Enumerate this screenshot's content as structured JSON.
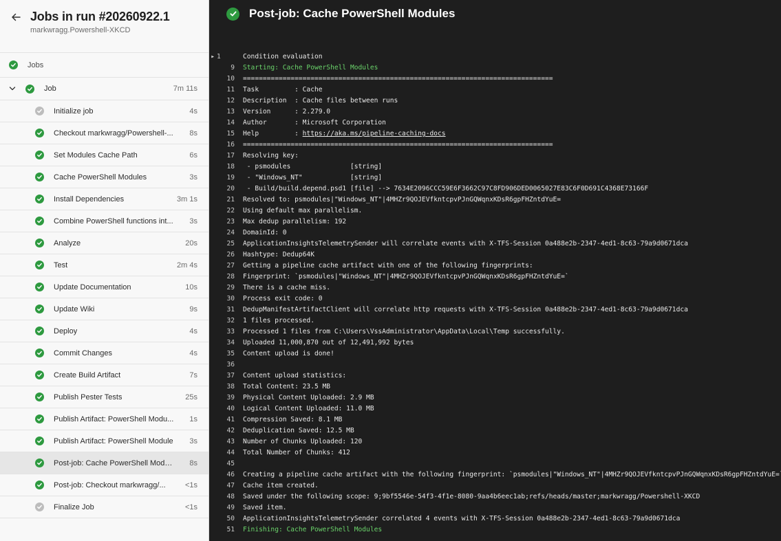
{
  "sidebar": {
    "title": "Jobs in run #20260922.1",
    "subtitle": "markwragg.Powershell-XKCD",
    "jobs_label": "Jobs",
    "job": {
      "label": "Job",
      "duration": "7m 11s"
    },
    "steps": [
      {
        "label": "Initialize job",
        "duration": "4s",
        "status": "skipped"
      },
      {
        "label": "Checkout markwragg/Powershell-...",
        "duration": "8s",
        "status": "succeeded"
      },
      {
        "label": "Set Modules Cache Path",
        "duration": "6s",
        "status": "succeeded"
      },
      {
        "label": "Cache PowerShell Modules",
        "duration": "3s",
        "status": "succeeded"
      },
      {
        "label": "Install Dependencies",
        "duration": "3m 1s",
        "status": "succeeded"
      },
      {
        "label": "Combine PowerShell functions int...",
        "duration": "3s",
        "status": "succeeded"
      },
      {
        "label": "Analyze",
        "duration": "20s",
        "status": "succeeded"
      },
      {
        "label": "Test",
        "duration": "2m 4s",
        "status": "succeeded"
      },
      {
        "label": "Update Documentation",
        "duration": "10s",
        "status": "succeeded"
      },
      {
        "label": "Update Wiki",
        "duration": "9s",
        "status": "succeeded"
      },
      {
        "label": "Deploy",
        "duration": "4s",
        "status": "succeeded"
      },
      {
        "label": "Commit Changes",
        "duration": "4s",
        "status": "succeeded"
      },
      {
        "label": "Create Build Artifact",
        "duration": "7s",
        "status": "succeeded"
      },
      {
        "label": "Publish Pester Tests",
        "duration": "25s",
        "status": "succeeded"
      },
      {
        "label": "Publish Artifact: PowerShell Modu...",
        "duration": "1s",
        "status": "succeeded"
      },
      {
        "label": "Publish Artifact: PowerShell Module",
        "duration": "3s",
        "status": "succeeded"
      },
      {
        "label": "Post-job: Cache PowerShell Modu...",
        "duration": "8s",
        "status": "succeeded",
        "selected": true
      },
      {
        "label": "Post-job: Checkout markwragg/...",
        "duration": "<1s",
        "status": "succeeded"
      },
      {
        "label": "Finalize Job",
        "duration": "<1s",
        "status": "skipped"
      }
    ]
  },
  "main": {
    "title": "Post-job: Cache PowerShell Modules",
    "log": [
      {
        "n": "1",
        "text": "Condition evaluation",
        "collapsed": true
      },
      {
        "n": "9",
        "text": "Starting: Cache PowerShell Modules",
        "style": "green"
      },
      {
        "n": "10",
        "text": "=============================================================================="
      },
      {
        "n": "11",
        "text": "Task         : Cache"
      },
      {
        "n": "12",
        "text": "Description  : Cache files between runs"
      },
      {
        "n": "13",
        "text": "Version      : 2.279.0"
      },
      {
        "n": "14",
        "text": "Author       : Microsoft Corporation"
      },
      {
        "n": "15",
        "text": "Help         : ",
        "link": "https://aka.ms/pipeline-caching-docs"
      },
      {
        "n": "16",
        "text": "=============================================================================="
      },
      {
        "n": "17",
        "text": "Resolving key:"
      },
      {
        "n": "18",
        "text": " - psmodules               [string]"
      },
      {
        "n": "19",
        "text": " - \"Windows_NT\"            [string]"
      },
      {
        "n": "20",
        "text": " - Build/build.depend.psd1 [file] --> 7634E2096CCC59E6F3662C97C8FD906DED0065027E83C6F0D691C4368E73166F"
      },
      {
        "n": "21",
        "text": "Resolved to: psmodules|\"Windows_NT\"|4MHZr9QOJEVfkntcpvPJnGQWqnxKDsR6gpFHZntdYuE="
      },
      {
        "n": "22",
        "text": "Using default max parallelism."
      },
      {
        "n": "23",
        "text": "Max dedup parallelism: 192"
      },
      {
        "n": "24",
        "text": "DomainId: 0"
      },
      {
        "n": "25",
        "text": "ApplicationInsightsTelemetrySender will correlate events with X-TFS-Session 0a488e2b-2347-4ed1-8c63-79a9d0671dca"
      },
      {
        "n": "26",
        "text": "Hashtype: Dedup64K"
      },
      {
        "n": "27",
        "text": "Getting a pipeline cache artifact with one of the following fingerprints:"
      },
      {
        "n": "28",
        "text": "Fingerprint: `psmodules|\"Windows_NT\"|4MHZr9QOJEVfkntcpvPJnGQWqnxKDsR6gpFHZntdYuE=`"
      },
      {
        "n": "29",
        "text": "There is a cache miss."
      },
      {
        "n": "30",
        "text": "Process exit code: 0"
      },
      {
        "n": "31",
        "text": "DedupManifestArtifactClient will correlate http requests with X-TFS-Session 0a488e2b-2347-4ed1-8c63-79a9d0671dca"
      },
      {
        "n": "32",
        "text": "1 files processed."
      },
      {
        "n": "33",
        "text": "Processed 1 files from C:\\Users\\VssAdministrator\\AppData\\Local\\Temp successfully."
      },
      {
        "n": "34",
        "text": "Uploaded 11,000,870 out of 12,491,992 bytes"
      },
      {
        "n": "35",
        "text": "Content upload is done!"
      },
      {
        "n": "36",
        "text": ""
      },
      {
        "n": "37",
        "text": "Content upload statistics:"
      },
      {
        "n": "38",
        "text": "Total Content: 23.5 MB"
      },
      {
        "n": "39",
        "text": "Physical Content Uploaded: 2.9 MB"
      },
      {
        "n": "40",
        "text": "Logical Content Uploaded: 11.0 MB"
      },
      {
        "n": "41",
        "text": "Compression Saved: 8.1 MB"
      },
      {
        "n": "42",
        "text": "Deduplication Saved: 12.5 MB"
      },
      {
        "n": "43",
        "text": "Number of Chunks Uploaded: 120"
      },
      {
        "n": "44",
        "text": "Total Number of Chunks: 412"
      },
      {
        "n": "45",
        "text": ""
      },
      {
        "n": "46",
        "text": "Creating a pipeline cache artifact with the following fingerprint: `psmodules|\"Windows_NT\"|4MHZr9QOJEVfkntcpvPJnGQWqnxKDsR6gpFHZntdYuE=`"
      },
      {
        "n": "47",
        "text": "Cache item created."
      },
      {
        "n": "48",
        "text": "Saved under the following scope: 9;9bf5546e-54f3-4f1e-8080-9aa4b6eec1ab;refs/heads/master;markwragg/Powershell-XKCD"
      },
      {
        "n": "49",
        "text": "Saved item."
      },
      {
        "n": "50",
        "text": "ApplicationInsightsTelemetrySender correlated 4 events with X-TFS-Session 0a488e2b-2347-4ed1-8c63-79a9d0671dca"
      },
      {
        "n": "51",
        "text": "Finishing: Cache PowerShell Modules",
        "style": "green"
      }
    ]
  }
}
